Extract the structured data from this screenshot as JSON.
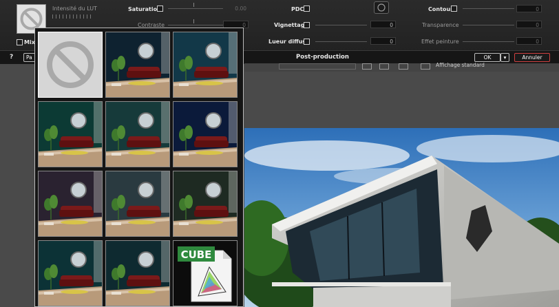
{
  "panel": {
    "lut_intensity_label": "Intensité du LUT",
    "mix_label": "Mixe",
    "help_label": "?",
    "partial_button_label": "Pa",
    "title": "Post-production",
    "ok_label": "OK",
    "cancel_label": "Annuler",
    "saturation": {
      "label": "Saturation",
      "value": "0.00"
    },
    "contrast": {
      "label": "Contraste",
      "value": "0"
    },
    "pdc": {
      "label": "PDC"
    },
    "vignetting": {
      "label": "Vignettage",
      "value": "0"
    },
    "diffuse_glow": {
      "label": "Lueur diffuse",
      "value": "0"
    },
    "contour": {
      "label": "Contour",
      "value": "0"
    },
    "transparency": {
      "label": "Transparence",
      "value": "0"
    },
    "paint_effect": {
      "label": "Effet peinture",
      "value": "0"
    }
  },
  "toolbar2": {
    "display_label": "Affichage standard"
  },
  "lut_menu": {
    "items": [
      {
        "name": "none",
        "tint": "#b8b8b8"
      },
      {
        "name": "lut-1",
        "tint": "#0e2230"
      },
      {
        "name": "lut-2",
        "tint": "#123848"
      },
      {
        "name": "lut-3",
        "tint": "#0c3a34"
      },
      {
        "name": "lut-4",
        "tint": "#163a3a"
      },
      {
        "name": "lut-5",
        "tint": "#0b1a3a"
      },
      {
        "name": "lut-6",
        "tint": "#2a2230"
      },
      {
        "name": "lut-7",
        "tint": "#2a3a40"
      },
      {
        "name": "lut-8",
        "tint": "#1e2a22"
      },
      {
        "name": "lut-9",
        "tint": "#0c3236"
      },
      {
        "name": "lut-10",
        "tint": "#0e2a30"
      },
      {
        "name": "cube-file",
        "tint": "#ffffff"
      }
    ],
    "cube_label": "CUBE"
  },
  "colors": {
    "cancel_border": "#d04040",
    "cube_green": "#2f8a3e"
  }
}
